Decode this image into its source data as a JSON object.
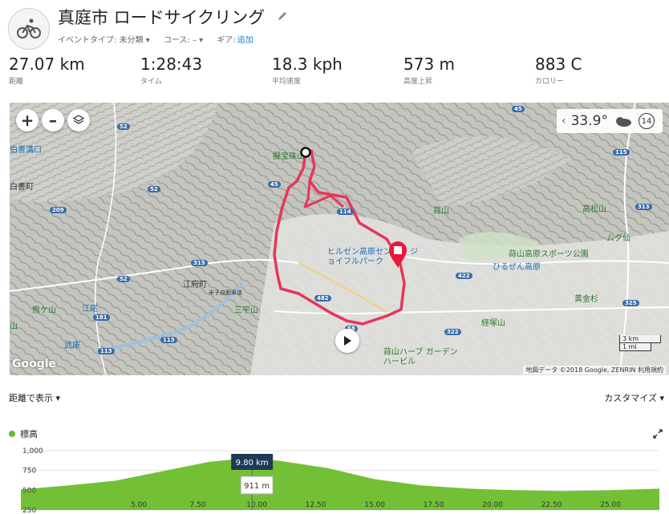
{
  "activity": {
    "title": "真庭市 ロードサイクリング",
    "event_type": "イベントタイプ: 未分類 ▾",
    "course": "コース: – ▾",
    "gear_label": "ギア:",
    "gear_link": "追加"
  },
  "stats": [
    {
      "value": "27.07 km",
      "label": "距離"
    },
    {
      "value": "1:28:43",
      "label": "タイム"
    },
    {
      "value": "18.3 kph",
      "label": "平均速度"
    },
    {
      "value": "573 m",
      "label": "高度上昇"
    },
    {
      "value": "883 C",
      "label": "カロリー"
    }
  ],
  "map": {
    "zoom_in": "+",
    "zoom_out": "–",
    "weather": {
      "temp": "33.9°",
      "wind": "14"
    },
    "scale_km": "3 km",
    "scale_mi": "1 mi",
    "logo": "Google",
    "attribution": "地図データ ©2018 Google, ZENRIN 利用規約",
    "labels": [
      {
        "text": "伯耆溝口",
        "color": "#1b6fb8"
      },
      {
        "text": "擬宝珠山",
        "color": "#2a7a2a"
      },
      {
        "text": "蒜山",
        "color": "#2a7a2a"
      },
      {
        "text": "高松山",
        "color": "#2a7a2a"
      },
      {
        "text": "ムグ仙",
        "color": "#2a7a2a"
      },
      {
        "text": "ヒルゼン高原センター ジョイフルパーク",
        "color": "#1b6fb8"
      },
      {
        "text": "蒜山高原スポーツ公園",
        "color": "#2a7a2a"
      },
      {
        "text": "ひるぜん高原",
        "color": "#1b6fb8"
      },
      {
        "text": "江府町",
        "color": "#333"
      },
      {
        "text": "米子自動車道",
        "color": "#333"
      },
      {
        "text": "三平山",
        "color": "#2a7a2a"
      },
      {
        "text": "黄金杉",
        "color": "#2a7a2a"
      },
      {
        "text": "経塚山",
        "color": "#2a7a2a"
      },
      {
        "text": "蒜山ハーブ ガーデン ハービル",
        "color": "#2a7a2a"
      },
      {
        "text": "江尾",
        "color": "#1b6fb8"
      },
      {
        "text": "武庫",
        "color": "#1b6fb8"
      },
      {
        "text": "熊ケ山",
        "color": "#2a7a2a"
      },
      {
        "text": "白書町",
        "color": "#333"
      },
      {
        "text": "山",
        "color": "#2a7a2a"
      }
    ],
    "route_shields": [
      "52",
      "52",
      "52",
      "209",
      "315",
      "181",
      "113",
      "113",
      "45",
      "45",
      "115",
      "313",
      "325",
      "422",
      "322",
      "58",
      "114",
      "482"
    ]
  },
  "toolbar": {
    "distance_mode": "距離で表示 ▾",
    "customize": "カスタマイズ ▾"
  },
  "elevation": {
    "legend": "標高",
    "tooltip_distance": "9.80 km",
    "tooltip_value": "911 m"
  },
  "chart_data": {
    "type": "area",
    "title": "",
    "xlabel": "",
    "ylabel": "",
    "series": [
      {
        "name": "標高",
        "color": "#6cbd2b"
      }
    ],
    "x": [
      0,
      2,
      4,
      6,
      8,
      9.8,
      11,
      13,
      15,
      17,
      19,
      21,
      23,
      25,
      27.07
    ],
    "y": [
      510,
      560,
      620,
      740,
      860,
      911,
      870,
      780,
      640,
      560,
      520,
      500,
      490,
      500,
      520
    ],
    "yticks": [
      "1,000",
      "750",
      "500",
      "250"
    ],
    "xticks": [
      "5.00",
      "7.50",
      "10.00",
      "12.50",
      "15.00",
      "17.50",
      "20.00",
      "22.50",
      "25.00"
    ],
    "ylim": [
      250,
      1000
    ],
    "xlim": [
      0,
      27.07
    ]
  },
  "colors": {
    "route": "#e8355a",
    "elevation": "#6cbd2b",
    "link": "#1a7ecc"
  }
}
